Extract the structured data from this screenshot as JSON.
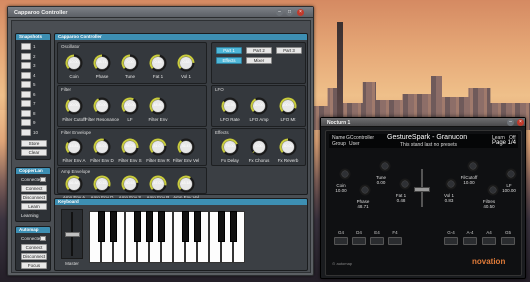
{
  "colors": {
    "accent": "#3d8fb3",
    "active_button": "#4fb7d8",
    "knob_arc": "#c9cc3c",
    "knob_body": "#e8e8e8"
  },
  "main_window": {
    "title": "Capparoo Controller"
  },
  "snapshots": {
    "title": "Snapshots",
    "numbers": [
      "1",
      "2",
      "3",
      "4",
      "5",
      "6",
      "7",
      "8",
      "9",
      "10"
    ],
    "store": "Store",
    "clear": "Clear"
  },
  "copperlan": {
    "title": "CopperLan",
    "status": "Connected",
    "connect": "Connect",
    "disconnect": "Disconnect",
    "learn_mode": "Learn Mode",
    "learning": "Learning"
  },
  "automap": {
    "title": "Automap",
    "status": "Connected",
    "connect": "Connect",
    "disconnect": "Disconnect",
    "focus": "Focus"
  },
  "panel_title": "Capparoo Controller",
  "oscillator": {
    "title": "Oscillator",
    "knobs": [
      {
        "label": "Coin",
        "value": "10.00",
        "level": 0.5
      },
      {
        "label": "Phase",
        "value": "48.71",
        "level": 0.5
      },
      {
        "label": "Tune",
        "value": "0.00",
        "level": 0.5
      },
      {
        "label": "Fat 1",
        "value": "0.48",
        "level": 0.55
      },
      {
        "label": "Vol 1",
        "value": "0.83",
        "level": 0.83
      }
    ]
  },
  "parts": {
    "part1": "Part 1",
    "part2": "Part 2",
    "part3": "Part 3",
    "effects": "Effects",
    "mixer": "Mixer"
  },
  "filter": {
    "title": "Filter",
    "knobs": [
      {
        "label": "Filter Cutoff",
        "value": "20.00",
        "level": 0.35
      },
      {
        "label": "Filter Resonance",
        "value": "40.00",
        "level": 0.4
      },
      {
        "label": "LF",
        "value": "100.00",
        "level": 0.6
      },
      {
        "label": "Filter Env",
        "value": "48.80",
        "level": 0.55
      }
    ]
  },
  "lfo": {
    "title": "LFO",
    "knobs": [
      {
        "label": "LFO Rate",
        "value": "22.39",
        "level": 0.3
      },
      {
        "label": "LFO Amp",
        "value": "10.00",
        "level": 0.4
      },
      {
        "label": "LFO Mt",
        "value": "100.00",
        "level": 0.9
      }
    ]
  },
  "filter_envelope": {
    "title": "Filter Envelope",
    "knobs": [
      {
        "label": "Filter Env A",
        "value": "15.81",
        "level": 0.3
      },
      {
        "label": "Filter Env D",
        "value": "55.01",
        "level": 0.55
      },
      {
        "label": "Filter Env S",
        "value": "86.03",
        "level": 0.86
      },
      {
        "label": "Filter Env R",
        "value": "81.07",
        "level": 0.8
      },
      {
        "label": "Filter Env Vel",
        "value": "36.47",
        "level": 0.36
      }
    ]
  },
  "effects": {
    "title": "Effects",
    "knobs": [
      {
        "label": "Fx Delay",
        "value": "75.00",
        "level": 0.75
      },
      {
        "label": "Fx Chorus",
        "value": "0.00",
        "level": 0.02
      },
      {
        "label": "Fx Reverb",
        "value": "50.00",
        "level": 0.5
      }
    ]
  },
  "amp_envelope": {
    "title": "Amp Envelope",
    "knobs": [
      {
        "label": "Amp Env A",
        "value": "66.88",
        "level": 0.65
      },
      {
        "label": "Amp Env D",
        "value": "90.22",
        "level": 0.9
      },
      {
        "label": "Amp Env S",
        "value": "80.63",
        "level": 0.8
      },
      {
        "label": "Amp Env R",
        "value": "87.09",
        "level": 0.87
      },
      {
        "label": "Amp Env Vel",
        "value": "63.18",
        "level": 0.63
      }
    ]
  },
  "keyboard": {
    "title": "Keyboard",
    "master_label": "Master"
  },
  "nova_window": {
    "title": "Nocturn 1"
  },
  "nova": {
    "name_label": "Name",
    "name_value": "GCcontroller",
    "group_label": "Group",
    "group_value": "User",
    "patch_title": "GestureSpark - Granucon",
    "patch_sub": "This stand last no presets",
    "learn_label": "Learn",
    "learn_value": "Off",
    "page": "Page 1/4",
    "knobs": [
      {
        "label": "Coin",
        "value": "10.00"
      },
      {
        "label": "Phase",
        "value": "48.71"
      },
      {
        "label": "Tune",
        "value": "0.00"
      },
      {
        "label": "Fat 1",
        "value": "0.48"
      },
      {
        "label": "Vol 1",
        "value": "0.83"
      },
      {
        "label": "FilCutoff",
        "value": "10.00"
      },
      {
        "label": "Filtres",
        "value": "40.50"
      },
      {
        "label": "LF",
        "value": "100.00"
      }
    ],
    "buttons_left": [
      "G4",
      "D4",
      "E4",
      "F4"
    ],
    "buttons_right": [
      "G-4",
      "A-4",
      "A4",
      "G5"
    ],
    "brand": "novation"
  }
}
